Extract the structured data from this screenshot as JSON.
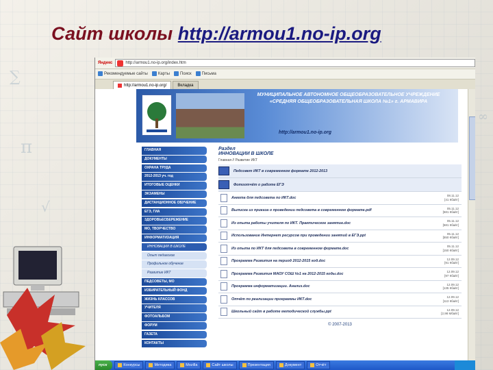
{
  "slide": {
    "title_text": "Сайт школы ",
    "title_url": "http://armou1.no-ip.org"
  },
  "browser": {
    "address": "http://armou1.no-ip.org/index.htm",
    "search_brand": "Яндекс",
    "toolbar_items": [
      "Рекомендуемые сайты",
      "Карты",
      "Поиск",
      "Письма"
    ],
    "tabs": [
      {
        "label": "http://armou1.no-ip.org/"
      },
      {
        "label": "Вкладка"
      }
    ]
  },
  "site": {
    "school_name": "МУНИЦИПАЛЬНОЕ АВТОНОМНОЕ ОБЩЕОБРАЗОВАТЕЛЬНОЕ УЧРЕЖДЕНИЕ «СРЕДНЯЯ ОБЩЕОБРАЗОВАТЕЛЬНАЯ ШКОЛА №1» г. АРМАВИРА",
    "school_url": "http://armou1.no-ip.org",
    "menu": [
      {
        "label": "ГЛАВНАЯ",
        "type": "main"
      },
      {
        "label": "ДОКУМЕНТЫ",
        "type": "main"
      },
      {
        "label": "ОХРАНА ТРУДА",
        "type": "main"
      },
      {
        "label": "2012-2013 уч. год",
        "type": "main"
      },
      {
        "label": "ИТОГОВЫЕ ОЦЕНКИ",
        "type": "main"
      },
      {
        "label": "ЭКЗАМЕНЫ",
        "type": "main"
      },
      {
        "label": "ДИСТАНЦИОННОЕ ОБУЧЕНИЕ",
        "type": "main"
      },
      {
        "label": "ЕГЭ, ГИА",
        "type": "main"
      },
      {
        "label": "ЗДОРОВЬЕСБЕРЕЖЕНИЕ",
        "type": "main"
      },
      {
        "label": "МО, ТВОРЧЕСТВО",
        "type": "main"
      },
      {
        "label": "ИНФОРМАТИЗАЦИЯ",
        "type": "main"
      },
      {
        "label": "ИННОВАЦИИ В ШКОЛЕ",
        "type": "sub-active"
      },
      {
        "label": "Опыт педагогов",
        "type": "sub"
      },
      {
        "label": "Профильное обучение",
        "type": "sub"
      },
      {
        "label": "Развитие ИКТ",
        "type": "sub"
      },
      {
        "label": "ПЕДСОВЕТЫ, МО",
        "type": "main"
      },
      {
        "label": "ИЗБИРАТЕЛЬНЫЙ ФОНД",
        "type": "main"
      },
      {
        "label": "ЖИЗНЬ КЛАССОВ",
        "type": "main"
      },
      {
        "label": "УЧИТЕЛЯ",
        "type": "main"
      },
      {
        "label": "ФОТОАЛЬБОМ",
        "type": "main"
      },
      {
        "label": "ФОРУМ",
        "type": "main"
      },
      {
        "label": "ГАЗЕТА",
        "type": "main"
      },
      {
        "label": "КОНТАКТЫ",
        "type": "main"
      }
    ],
    "section_label": "Раздел",
    "section_title": "ИННОВАЦИИ В ШКОЛЕ",
    "breadcrumb": "Главная // Развитие ИКТ",
    "folders": [
      "Педсовет ИКТ в современном формате 2012-2013",
      "Фотоотчёт о работе ЕГЭ"
    ],
    "files": [
      {
        "title": "Анкета для педсовета по ИКТ.doc",
        "date": "08.11.12",
        "size": "[41 Кбайт]"
      },
      {
        "title": "Выписка из приказа о проведении педсовета в современном формате.pdf",
        "date": "05.11.12",
        "size": "[581 Кбайт]"
      },
      {
        "title": "Из опыта работы учителя по ИКТ. Практическое занятие.doc",
        "date": "05.11.12",
        "size": "[581 Кбайт]"
      },
      {
        "title": "Использование Интернет ресурсов при проведении занятий в ЕГЭ.ppt",
        "date": "05.11.12",
        "size": "[550 Кбайт]"
      },
      {
        "title": "Из опыта по ИКТ для педсовета в современном формате.doc",
        "date": "05.11.12",
        "size": "[150 Кбайт]"
      },
      {
        "title": "Программа Развития на период 2012-2015 год.doc",
        "date": "12.09.12",
        "size": "[91 Кбайт]"
      },
      {
        "title": "Программа Развития МАОУ СОШ №1 на 2012-2015 годы.doc",
        "date": "12.09.12",
        "size": "[97 Кбайт]"
      },
      {
        "title": "Программа информатизации. Анализ.doc",
        "date": "12.09.12",
        "size": "[135 Кбайт]"
      },
      {
        "title": "Отчёт по реализации программы ИКТ.doc",
        "date": "12.09.12",
        "size": "[113 Кбайт]"
      },
      {
        "title": "Школьный сайт в работе методической службы.ppt",
        "date": "12.09.12",
        "size": "[2,98 Мбайт]"
      }
    ],
    "footer": "© 2007-2013"
  },
  "taskbar": {
    "start_label": "пуск",
    "tasks": [
      "Конкурсы",
      "Методика",
      "Mozilla",
      "Сайт школы",
      "Презентация",
      "Документ",
      "Отчёт"
    ]
  }
}
